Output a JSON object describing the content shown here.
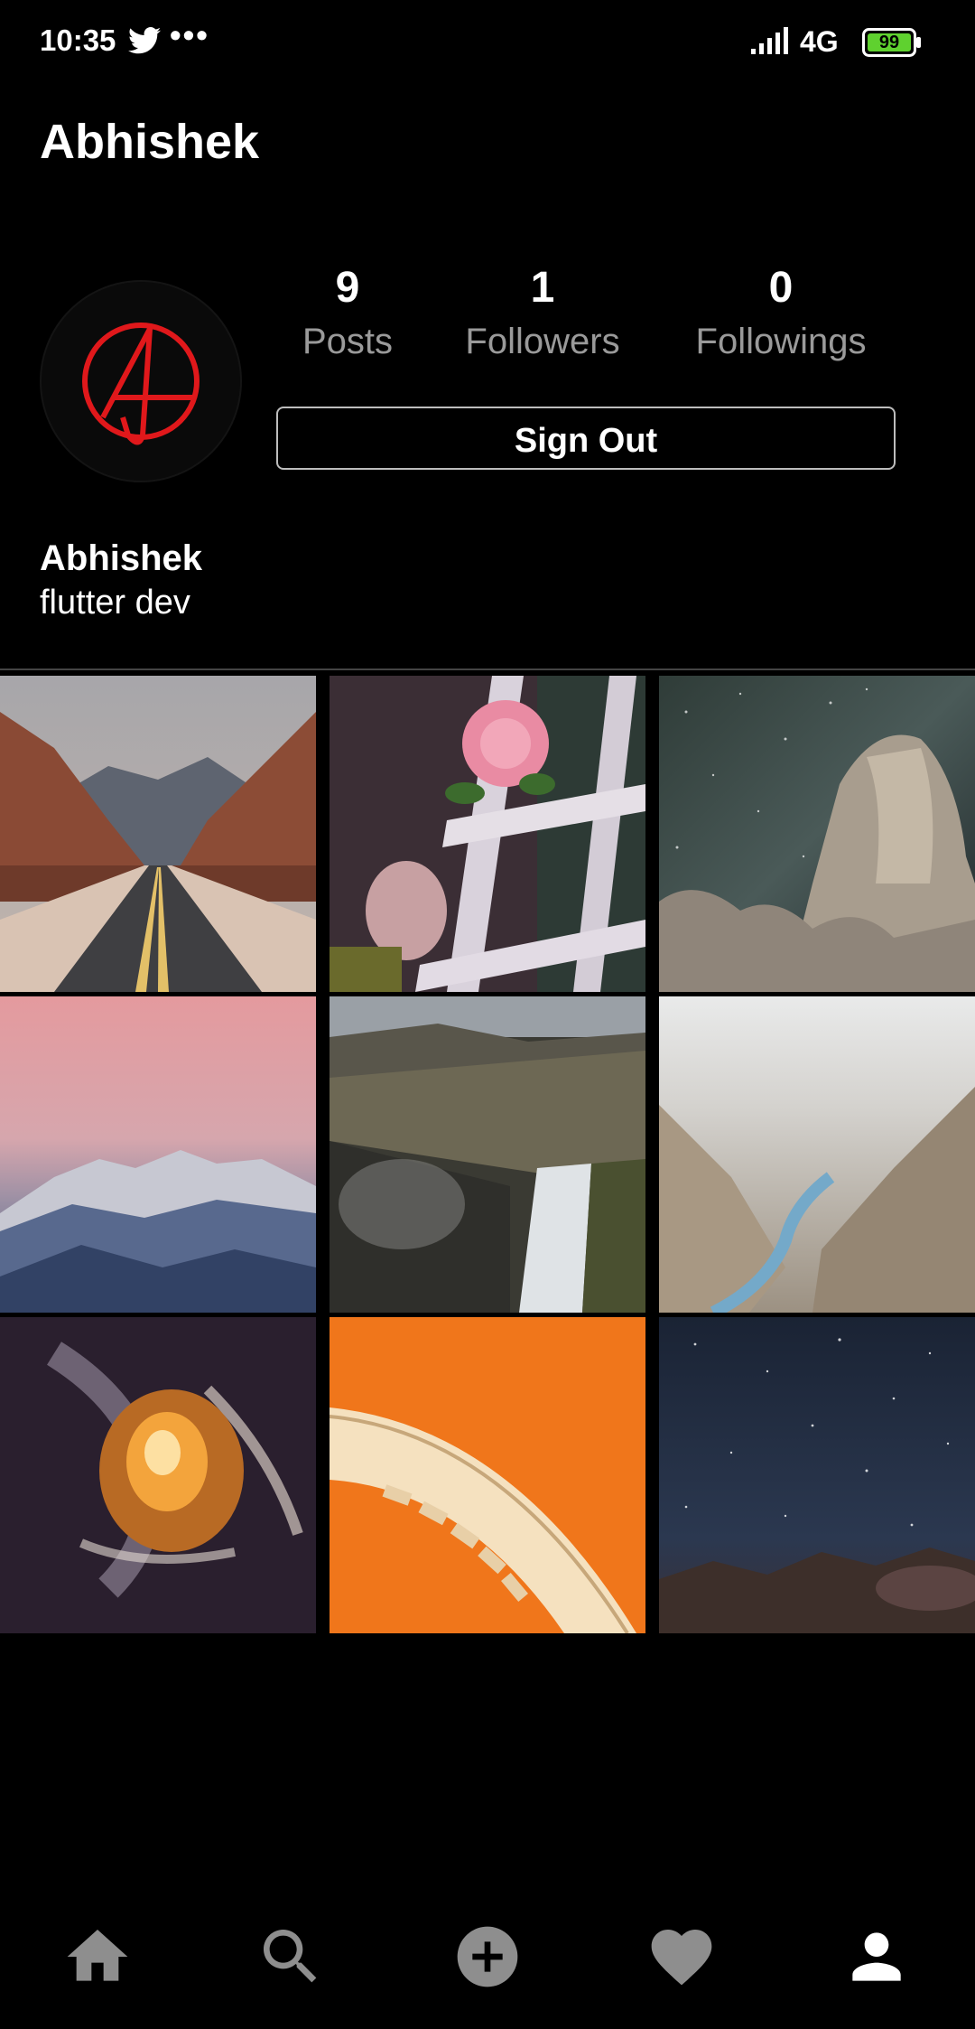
{
  "status_bar": {
    "time": "10:35",
    "dots": "•••",
    "network": "4G",
    "battery": "99",
    "icons": [
      "twitter-icon",
      "cellular-signal-icon",
      "battery-icon"
    ]
  },
  "header": {
    "title": "Abhishek"
  },
  "profile": {
    "avatar_icon": "anarchy-a-logo",
    "stats": [
      {
        "value": "9",
        "label": "Posts"
      },
      {
        "value": "1",
        "label": "Followers"
      },
      {
        "value": "0",
        "label": "Followings"
      }
    ],
    "sign_out_label": "Sign Out",
    "name": "Abhishek",
    "bio": "flutter dev"
  },
  "grid": {
    "posts": [
      {
        "scene": "desert-road"
      },
      {
        "scene": "pink-rose-window"
      },
      {
        "scene": "night-rock-milky-way"
      },
      {
        "scene": "pink-sky-mountains"
      },
      {
        "scene": "waterfall-valley"
      },
      {
        "scene": "misty-river-canyon"
      },
      {
        "scene": "abstract-fluid-orange"
      },
      {
        "scene": "orange-stairs"
      },
      {
        "scene": "starry-night-sky"
      }
    ]
  },
  "bottom_nav": {
    "items": [
      "home-icon",
      "search-icon",
      "add-post-icon",
      "heart-icon",
      "profile-icon"
    ],
    "active": "profile-icon",
    "colors": {
      "active": "#ffffff",
      "inactive": "#8e8e8e"
    }
  }
}
